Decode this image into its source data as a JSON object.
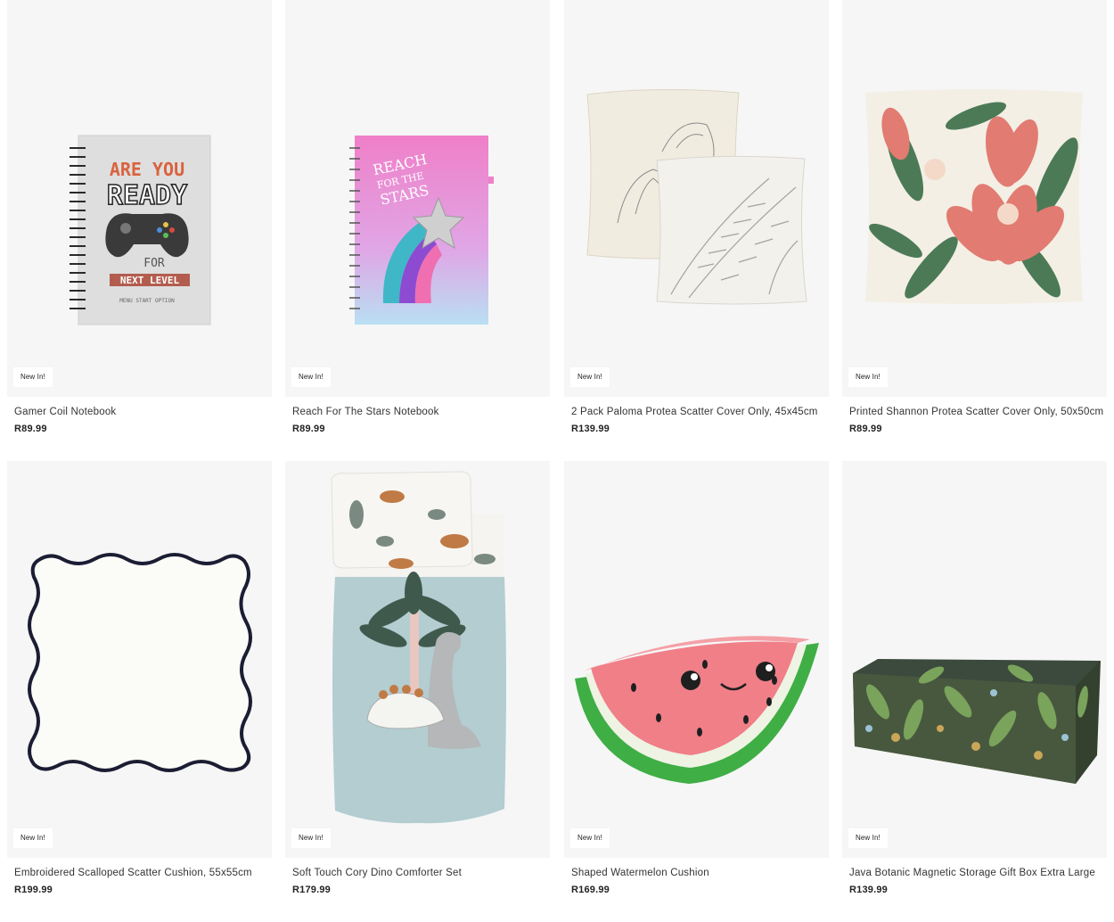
{
  "products": [
    {
      "name": "Gamer Coil Notebook",
      "price": "R89.99",
      "badge": "New In!",
      "image_icon": "gamer-notebook-image",
      "cover_text": [
        "ARE YOU",
        "READY",
        "FOR",
        "NEXT LEVEL",
        "MENU START OPTION"
      ]
    },
    {
      "name": "Reach For The Stars Notebook",
      "price": "R89.99",
      "badge": "New In!",
      "image_icon": "stars-notebook-image",
      "cover_text": [
        "REACH",
        "FOR THE",
        "STARS"
      ]
    },
    {
      "name": "2 Pack Paloma Protea Scatter Cover Only, 45x45cm",
      "price": "R139.99",
      "badge": "New In!",
      "image_icon": "protea-cushion-pair-image"
    },
    {
      "name": "Printed Shannon Protea Scatter Cover Only, 50x50cm",
      "price": "R89.99",
      "badge": "New In!",
      "image_icon": "protea-cushion-image"
    },
    {
      "name": "Embroidered Scalloped Scatter Cushion, 55x55cm",
      "price": "R199.99",
      "badge": "New In!",
      "image_icon": "scalloped-cushion-image"
    },
    {
      "name": "Soft Touch Cory Dino Comforter Set",
      "price": "R179.99",
      "badge": "New In!",
      "image_icon": "dino-comforter-image"
    },
    {
      "name": "Shaped Watermelon Cushion",
      "price": "R169.99",
      "badge": "New In!",
      "image_icon": "watermelon-cushion-image"
    },
    {
      "name": "Java Botanic Magnetic Storage Gift Box Extra Large",
      "price": "R139.99",
      "badge": "New In!",
      "image_icon": "botanic-gift-box-image"
    }
  ]
}
